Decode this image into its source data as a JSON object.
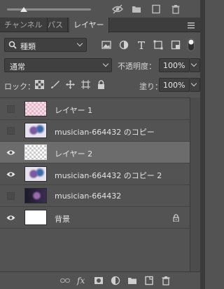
{
  "tabs": [
    {
      "label": "チャンネル",
      "active": false
    },
    {
      "label": "パス",
      "active": false
    },
    {
      "label": "レイヤー",
      "active": true
    }
  ],
  "filter": {
    "selected": "種類",
    "icons": [
      "image-filter-icon",
      "adjustment-filter-icon",
      "type-filter-icon",
      "shape-filter-icon",
      "smart-object-filter-icon",
      "filter-toggle-icon"
    ]
  },
  "blend": {
    "mode": "通常",
    "opacity_label": "不透明度：",
    "opacity_value": "100%"
  },
  "lock": {
    "label": "ロック：",
    "fill_label": "塗り：",
    "fill_value": "100%"
  },
  "layers": [
    {
      "name": "レイヤー 1",
      "visible": false,
      "selected": false,
      "thumb": "pink-transparent"
    },
    {
      "name": "musician-664432 のコピー",
      "visible": false,
      "selected": false,
      "thumb": "art"
    },
    {
      "name": "レイヤー 2",
      "visible": true,
      "selected": true,
      "thumb": "transparent"
    },
    {
      "name": "musician-664432 のコピー 2",
      "visible": true,
      "selected": false,
      "thumb": "art"
    },
    {
      "name": "musician-664432",
      "visible": false,
      "selected": false,
      "thumb": "art-dark"
    },
    {
      "name": "背景",
      "visible": true,
      "selected": false,
      "thumb": "white",
      "locked": true
    }
  ],
  "colors": {
    "panel": "#535353",
    "selected_row": "#6c6c6c",
    "tab_bar": "#3d3d3d"
  }
}
